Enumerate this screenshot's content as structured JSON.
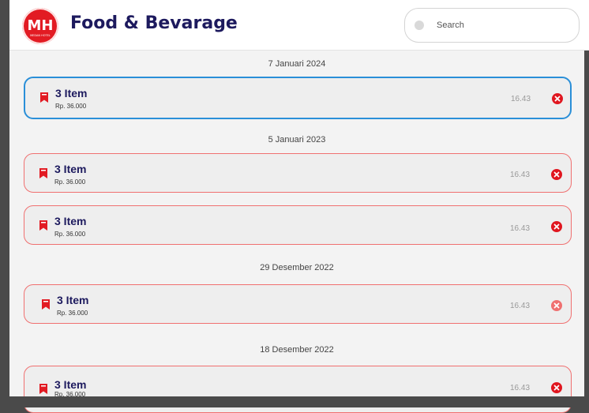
{
  "header": {
    "app_title": "Food & Bevarage",
    "logo_text": "MH",
    "logo_subtext": "MEDAN HOTEL"
  },
  "search": {
    "placeholder": "Search"
  },
  "groups": [
    {
      "date": "7 Januari 2024"
    },
    {
      "date": "5 Januari 2023"
    },
    {
      "date": "29 Desember 2022"
    },
    {
      "date": "18 Desember 2022"
    }
  ],
  "orders": [
    {
      "title": "3 Item",
      "price": "Rp. 36.000",
      "time": "16.43"
    },
    {
      "title": "3 Item",
      "price": "Rp. 36.000",
      "time": "16.43"
    },
    {
      "title": "3 Item",
      "price": "Rp. 36.000",
      "time": "16.43"
    },
    {
      "title": "3 Item",
      "price": "Rp. 36.000",
      "time": "16.43"
    },
    {
      "title": "3 Item",
      "price": "Rp. 36.000",
      "time": "16.43"
    }
  ],
  "colors": {
    "brand_red": "#e21b23",
    "title_navy": "#1d1a5e",
    "selected_border": "#2a8fd8",
    "card_border": "#f07070"
  }
}
